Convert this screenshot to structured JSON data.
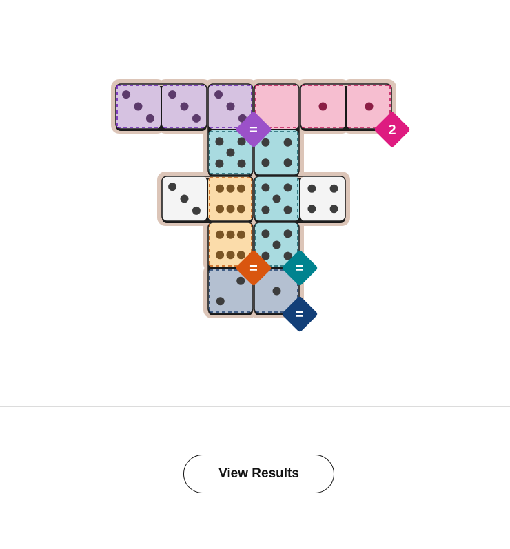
{
  "board": {
    "rows": 5,
    "cols": 6,
    "palette": {
      "frame": "#dcc5b8",
      "purple": {
        "fill": "#d6c2e1",
        "border": "#6a1fb5",
        "badge": "#9b51c9"
      },
      "pink": {
        "fill": "#f6bed0",
        "border": "#c2185b",
        "badge": "#de1b80"
      },
      "teal": {
        "fill": "#a9dbe0",
        "border": "#17616b",
        "badge": "#00838f"
      },
      "orange": {
        "fill": "#fbdcaa",
        "border": "#c25a10",
        "badge": "#d9560f"
      },
      "navy": {
        "fill": "#b4c0d1",
        "border": "#1d3e6e",
        "badge": "#123f78"
      },
      "plain": {
        "fill": "#f4f4f4",
        "border": "#222222"
      },
      "pip_dark": "#3d3d3d",
      "pip_purple": "#5c3a6b",
      "pip_pink": "#8b1e45",
      "pip_orange": "#7a5525"
    },
    "cells": [
      {
        "id": "r0c0",
        "row": 0,
        "col": 0,
        "pips": 3,
        "region": "purple"
      },
      {
        "id": "r0c1",
        "row": 0,
        "col": 1,
        "pips": 3,
        "region": "purple"
      },
      {
        "id": "r0c2",
        "row": 0,
        "col": 2,
        "pips": 3,
        "region": "purple"
      },
      {
        "id": "r0c3",
        "row": 0,
        "col": 3,
        "pips": 0,
        "region": "pink"
      },
      {
        "id": "r0c4",
        "row": 0,
        "col": 4,
        "pips": 1,
        "region": "pink"
      },
      {
        "id": "r0c5",
        "row": 0,
        "col": 5,
        "pips": 1,
        "region": "pink"
      },
      {
        "id": "r1c2",
        "row": 1,
        "col": 2,
        "pips": 5,
        "region": "teal"
      },
      {
        "id": "r1c3",
        "row": 1,
        "col": 3,
        "pips": 4,
        "region": "teal"
      },
      {
        "id": "r2c1",
        "row": 2,
        "col": 1,
        "pips": 3,
        "region": null
      },
      {
        "id": "r2c2",
        "row": 2,
        "col": 2,
        "pips": 6,
        "region": "orange"
      },
      {
        "id": "r2c3",
        "row": 2,
        "col": 3,
        "pips": 5,
        "region": "teal"
      },
      {
        "id": "r2c4",
        "row": 2,
        "col": 4,
        "pips": 4,
        "region": null
      },
      {
        "id": "r3c2",
        "row": 3,
        "col": 2,
        "pips": 6,
        "region": "orange"
      },
      {
        "id": "r3c3",
        "row": 3,
        "col": 3,
        "pips": 5,
        "region": "teal"
      },
      {
        "id": "r4c2",
        "row": 4,
        "col": 2,
        "pips": 2,
        "region": "navy"
      },
      {
        "id": "r4c3",
        "row": 4,
        "col": 3,
        "pips": 1,
        "region": "navy"
      }
    ],
    "dominoes": [
      {
        "id": "d1",
        "cells": [
          "r0c0",
          "r0c1"
        ]
      },
      {
        "id": "d2",
        "cells": [
          "r0c2",
          "r1c2"
        ]
      },
      {
        "id": "d3",
        "cells": [
          "r0c3",
          "r1c3"
        ]
      },
      {
        "id": "d4",
        "cells": [
          "r0c4",
          "r0c5"
        ]
      },
      {
        "id": "d5",
        "cells": [
          "r2c1",
          "r2c2"
        ]
      },
      {
        "id": "d6",
        "cells": [
          "r2c3",
          "r2c4"
        ]
      },
      {
        "id": "d7",
        "cells": [
          "r3c2",
          "r4c2"
        ]
      },
      {
        "id": "d8",
        "cells": [
          "r3c3",
          "r4c3"
        ]
      }
    ],
    "regions": [
      {
        "name": "purple",
        "cells": [
          [
            0,
            0
          ],
          [
            0,
            1
          ],
          [
            0,
            2
          ]
        ],
        "constraint": "=",
        "badge_at": [
          0,
          2
        ]
      },
      {
        "name": "pink",
        "cells": [
          [
            0,
            3
          ],
          [
            0,
            4
          ],
          [
            0,
            5
          ]
        ],
        "constraint": "2",
        "badge_at": [
          0,
          5
        ]
      },
      {
        "name": "teal",
        "cells": [
          [
            1,
            2
          ],
          [
            1,
            3
          ],
          [
            2,
            3
          ],
          [
            3,
            3
          ]
        ],
        "constraint": "=",
        "badge_at": [
          3,
          3
        ]
      },
      {
        "name": "orange",
        "cells": [
          [
            2,
            2
          ],
          [
            3,
            2
          ]
        ],
        "constraint": "=",
        "badge_at": [
          3,
          2
        ]
      },
      {
        "name": "navy",
        "cells": [
          [
            4,
            2
          ],
          [
            4,
            3
          ]
        ],
        "constraint": "=",
        "badge_at": [
          4,
          3
        ]
      }
    ]
  },
  "actions": {
    "view_results_label": "View Results"
  }
}
